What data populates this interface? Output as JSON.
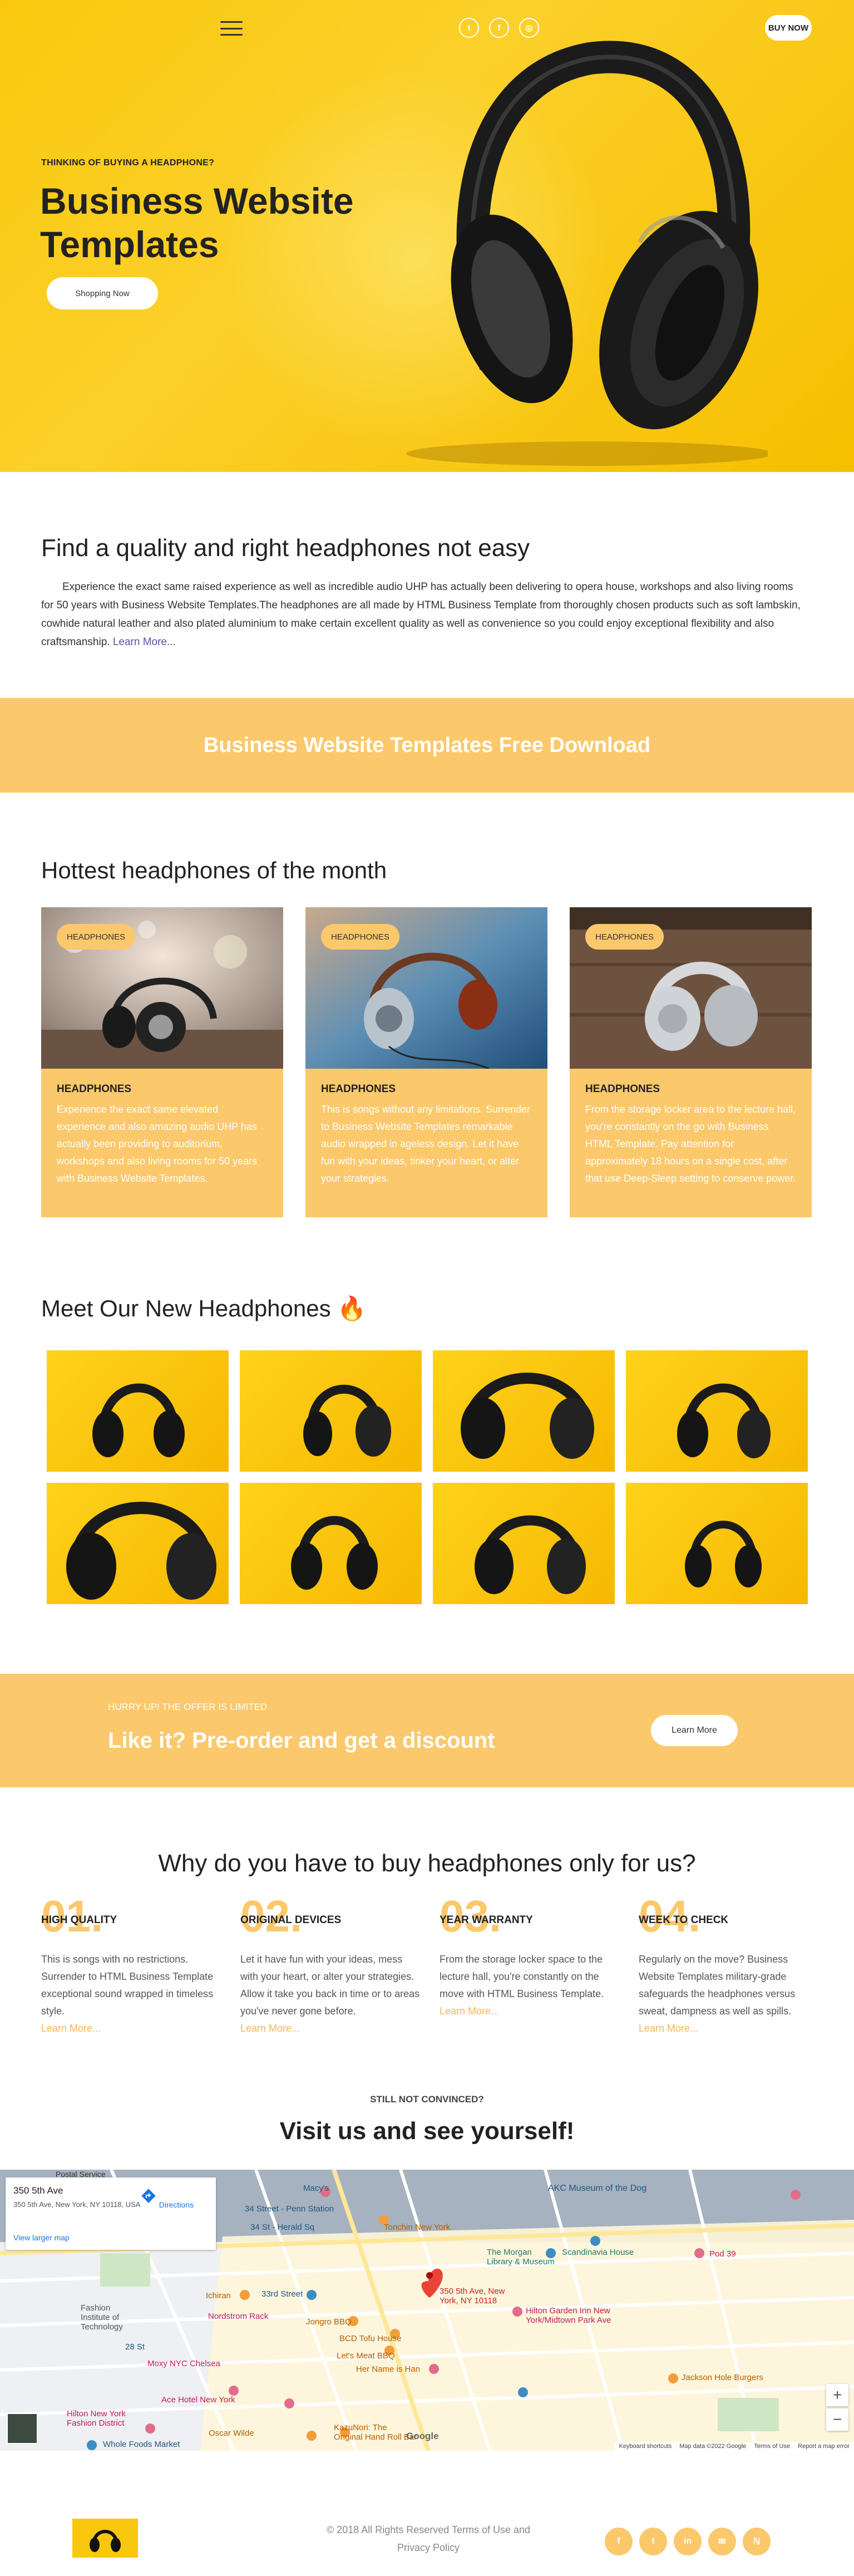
{
  "header": {
    "social": [
      "t",
      "f",
      "◎"
    ],
    "buy_now": "BUY NOW"
  },
  "hero": {
    "eyebrow": "THINKING OF BUYING A HEADPHONE?",
    "title": "Business Website Templates",
    "cta": "Shopping Now"
  },
  "quality": {
    "heading": "Find a quality and right headphones not easy",
    "text": "Experience the exact same raised experience as well as incredible audio UHP has actually been delivering to opera house, workshops and also living rooms for 50 years with Business Website Templates.The headphones are all made by HTML Business Template from thoroughly chosen products such as soft lambskin, cowhide natural leather and also plated aluminium to make certain excellent quality as well as convenience so you could enjoy exceptional flexibility and also craftsmanship.",
    "learn_more": "Learn More..."
  },
  "download_band": {
    "label": "Business Website Templates Free Download"
  },
  "hottest": {
    "heading": "Hottest headphones of the month",
    "cards": [
      {
        "badge": "HEADPHONES",
        "title": "HEADPHONES",
        "text": "Experience the exact same elevated experience and also amazing audio UHP has actually been providing to auditorium, workshops and also living rooms for 50 years with Business Website Templates."
      },
      {
        "badge": "HEADPHONES",
        "title": "HEADPHONES",
        "text": "This is songs without any limitations. Surrender to Business Website Templates remarkable audio wrapped in ageless design. Let it have fun with your ideas, tinker your heart, or alter your strategies."
      },
      {
        "badge": "HEADPHONES",
        "title": "HEADPHONES",
        "text": "From the storage locker area to the lecture hall, you're constantly on the go with Business HTML Template. Pay attention for approximately 18 hours on a single cost, after that use Deep-Sleep setting to conserve power."
      }
    ]
  },
  "meet": {
    "heading": "Meet Our New Headphones",
    "emoji": "🔥"
  },
  "offer": {
    "hurry": "HURRY UP! THE OFFER IS LIMITED",
    "title": "Like it? Pre-order and get a discount",
    "button": "Learn More"
  },
  "why": {
    "heading": "Why do you have to buy headphones only for us?",
    "features": [
      {
        "num": "01.",
        "title": "HIGH QUALITY",
        "text": "This is songs with no restrictions. Surrender to HTML Business Template exceptional sound wrapped in timeless style.",
        "more": "Learn More..."
      },
      {
        "num": "02.",
        "title": "ORIGINAL DEVICES",
        "text": "Let it have fun with your ideas, mess with your heart, or alter your strategies. Allow it take you back in time or to areas you've never gone before.",
        "more": "Learn More..."
      },
      {
        "num": "03.",
        "title": "YEAR WARRANTY",
        "text": "From the storage locker space to the lecture hall, you're constantly on the move with HTML Business Template.",
        "more": "Learn More..."
      },
      {
        "num": "04.",
        "title": "WEEK TO CHECK",
        "text": "Regularly on the move? Business Website Templates military-grade safeguards the headphones versus sweat, dampness as well as spills.",
        "more": "Learn More..."
      }
    ]
  },
  "visit": {
    "pre": "STILL NOT CONVINCED?",
    "title": "Visit us and see yourself!"
  },
  "map": {
    "place_name": "350 5th Ave",
    "place_address": "350 5th Ave, New York, NY 10118, USA",
    "directions": "Directions",
    "larger_map": "View larger map",
    "pin_label": "350 5th Ave, New York, NY 10118",
    "labels": [
      "Macy's",
      "34 Street - Penn Station",
      "34 St - Herald Sq",
      "Tonchin New York",
      "AKC Museum of the Dog",
      "The Morgan Library & Museum",
      "Scandinavia House",
      "Pod 39",
      "Ichiran",
      "Nordstrom Rack",
      "Jongro BBQ",
      "BCD Tofu House",
      "Let's Meat BBQ",
      "Her Name is Han",
      "Hilton Garden Inn New York/Midtown Park Ave",
      "Jackson Hole Burgers",
      "Moxy NYC Chelsea",
      "Ace Hotel New York",
      "Hilton New York Fashion District",
      "Oscar Wilde",
      "KazuNori: The Original Hand Roll Bar",
      "Whole Foods Market",
      "Fashion Institute of Technology",
      "28 St",
      "33rd Street",
      "Postal Service"
    ],
    "google": "Google",
    "footer": [
      "Keyboard shortcuts",
      "Map data ©2022 Google",
      "Terms of Use",
      "Report a map error"
    ]
  },
  "footer": {
    "copyright": "© 2018 All Rights Reserved Terms of Use and Privacy Policy",
    "social": [
      "f",
      "t",
      "in",
      "✉",
      "ℕ"
    ]
  }
}
